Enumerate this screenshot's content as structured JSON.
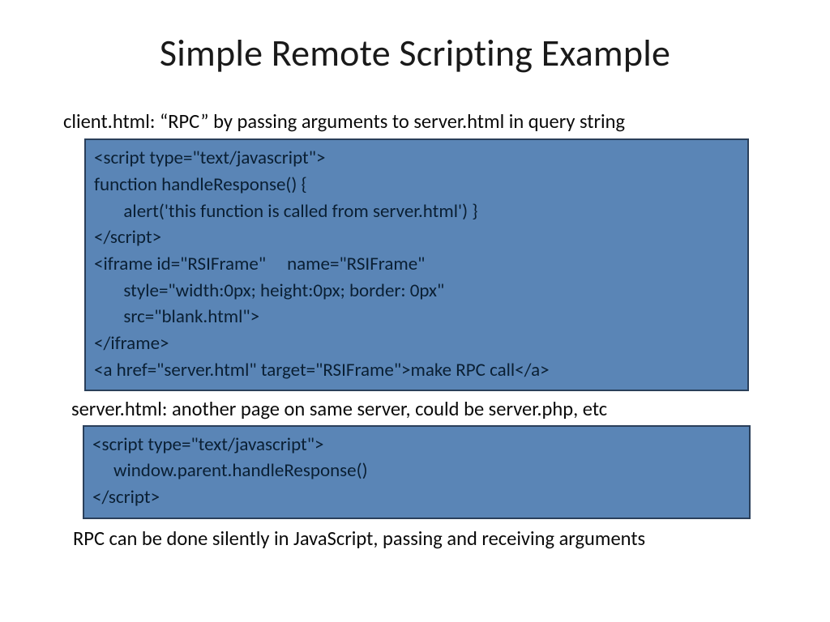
{
  "title": "Simple Remote Scripting Example",
  "caption_client": "client.html: “RPC” by passing arguments to server.html in query string",
  "code_client": "<script type=\"text/javascript\">\nfunction handleResponse() {\n       alert('this function is called from server.html') }\n</script>\n<iframe id=\"RSIFrame\"     name=\"RSIFrame\"\n       style=\"width:0px; height:0px; border: 0px\"\n       src=\"blank.html\">\n</iframe>\n<a href=\"server.html\" target=\"RSIFrame\">make RPC call</a>",
  "caption_server": "server.html: another page on same server, could be server.php, etc",
  "code_server": "<script type=\"text/javascript\">\n     window.parent.handleResponse()\n</script>",
  "caption_footer": "RPC can be done silently in JavaScript, passing and receiving arguments"
}
